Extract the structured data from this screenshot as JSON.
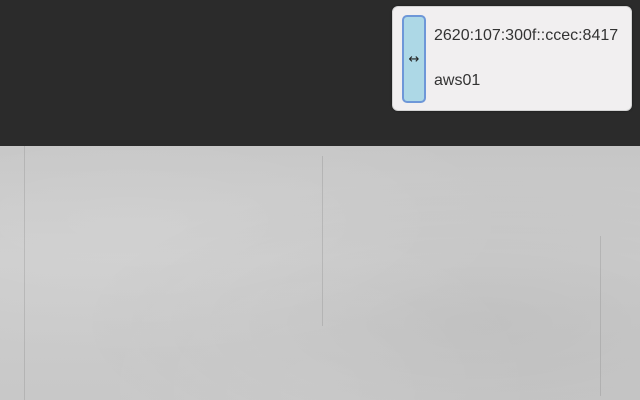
{
  "popup": {
    "ip_address": "2620:107:300f::ccec:8417",
    "hostname": "aws01",
    "swap_icon": "↔",
    "swap_icon_name": "left-right-arrow-icon"
  },
  "colors": {
    "top_bar": "#2b2b2b",
    "popup_background": "#f1eff0",
    "handle_fill": "#add8e6",
    "handle_border": "#6e97d8"
  }
}
